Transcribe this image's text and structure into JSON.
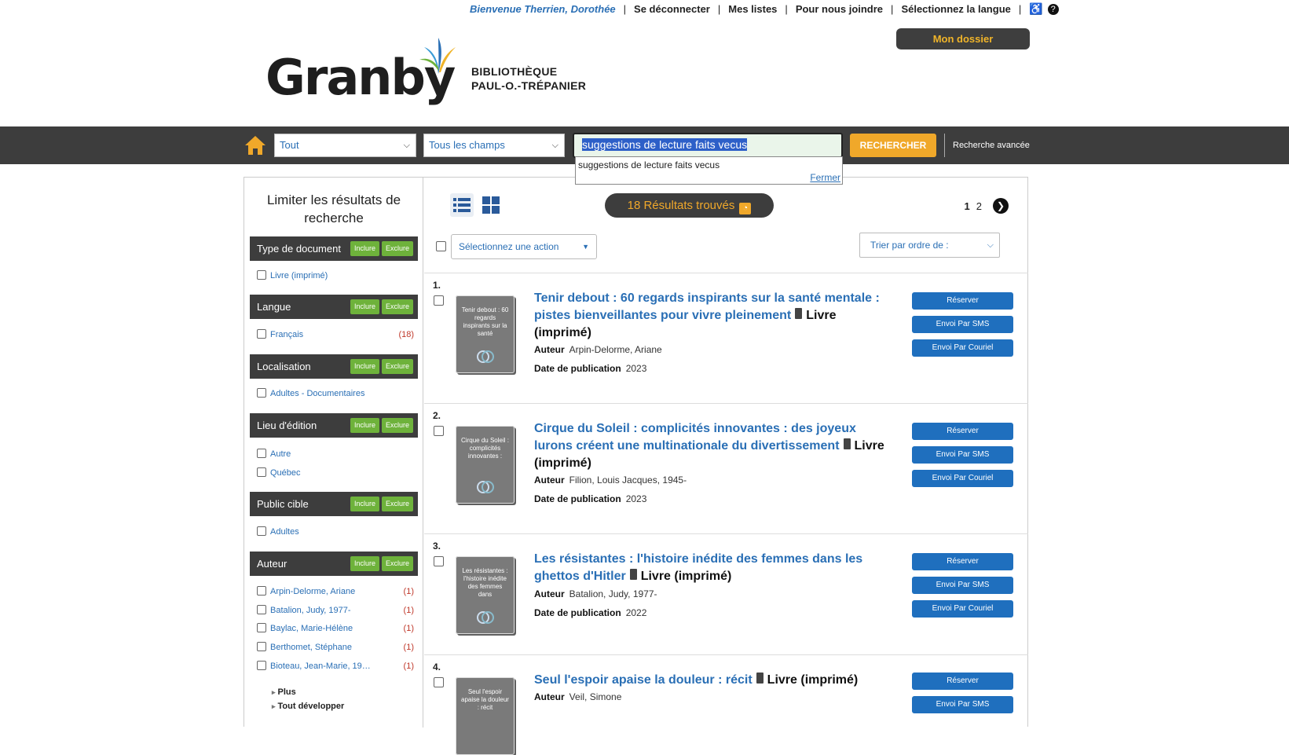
{
  "topbar": {
    "welcome": "Bienvenue Therrien, Dorothée",
    "logout": "Se déconnecter",
    "my_lists": "Mes listes",
    "contact": "Pour nous joindre",
    "language": "Sélectionnez la langue",
    "my_account": "Mon dossier"
  },
  "logo": {
    "wordmark": "Granby",
    "library_line1": "BIBLIOTHÈQUE",
    "library_line2": "PAUL-O.-TRÉPANIER"
  },
  "search": {
    "scope": "Tout",
    "field": "Tous les champs",
    "query": "suggestions de lecture faits vecus",
    "button": "RECHERCHER",
    "advanced": "Recherche avancée",
    "suggestion": "suggestions de lecture faits vecus",
    "close": "Fermer"
  },
  "sidebar": {
    "title": "Limiter les résultats de recherche",
    "include": "Inclure",
    "exclude": "Exclure",
    "facets": [
      {
        "name": "Type de document",
        "items": [
          {
            "label": "Livre (imprimé)",
            "count": ""
          }
        ]
      },
      {
        "name": "Langue",
        "items": [
          {
            "label": "Français",
            "count": "(18)"
          }
        ]
      },
      {
        "name": "Localisation",
        "items": [
          {
            "label": "Adultes - Documentaires",
            "count": ""
          }
        ]
      },
      {
        "name": "Lieu d'édition",
        "items": [
          {
            "label": "Autre",
            "count": ""
          },
          {
            "label": "Québec",
            "count": ""
          }
        ]
      },
      {
        "name": "Public cible",
        "items": [
          {
            "label": "Adultes",
            "count": ""
          }
        ]
      },
      {
        "name": "Auteur",
        "items": [
          {
            "label": "Arpin-Delorme, Ariane",
            "count": "(1)"
          },
          {
            "label": "Batalion, Judy, 1977-",
            "count": "(1)"
          },
          {
            "label": "Baylac, Marie-Hélène",
            "count": "(1)"
          },
          {
            "label": "Berthomet, Stéphane",
            "count": "(1)"
          },
          {
            "label": "Bioteau, Jean-Marie, 19…",
            "count": "(1)"
          }
        ]
      }
    ],
    "more": "Plus",
    "expand_all": "Tout développer"
  },
  "results": {
    "count_text": "18 Résultats trouvés",
    "pages": [
      "1",
      "2"
    ],
    "action_select": "Sélectionnez une action",
    "sort_select": "Trier par ordre de :",
    "buttons": {
      "reserve": "Réserver",
      "sms": "Envoi Par SMS",
      "email": "Envoi Par Couriel"
    },
    "labels": {
      "author": "Auteur",
      "date": "Date de publication"
    },
    "items": [
      {
        "num": "1.",
        "title": "Tenir debout : 60 regards inspirants sur la santé mentale : pistes bienveillantes pour vivre pleinement",
        "format": "Livre (imprimé)",
        "author": "Arpin-Delorme, Ariane",
        "date": "2023",
        "cover": "Tenir debout : 60 regards inspirants sur la santé"
      },
      {
        "num": "2.",
        "title": "Cirque du Soleil : complicités innovantes : des joyeux lurons créent une multinationale du divertissement",
        "format": "Livre (imprimé)",
        "author": "Filion, Louis Jacques, 1945-",
        "date": "2023",
        "cover": "Cirque du Soleil : complicités innovantes :"
      },
      {
        "num": "3.",
        "title": "Les résistantes : l'histoire inédite des femmes dans les ghettos d'Hitler",
        "format": "Livre (imprimé)",
        "author": "Batalion, Judy, 1977-",
        "date": "2022",
        "cover": "Les résistantes : l'histoire inédite des femmes dans"
      },
      {
        "num": "4.",
        "title": "Seul l'espoir apaise la douleur : récit",
        "format": "Livre (imprimé)",
        "author": "Veil, Simone",
        "date": "",
        "cover": "Seul l'espoir apaise la douleur : récit"
      }
    ]
  },
  "colors": {
    "accent_orange": "#f0a82a",
    "link_blue": "#2a6fb5",
    "bar_dark": "#3d3d3d",
    "include_green": "#6eb23b",
    "button_blue": "#1f6fbe"
  }
}
